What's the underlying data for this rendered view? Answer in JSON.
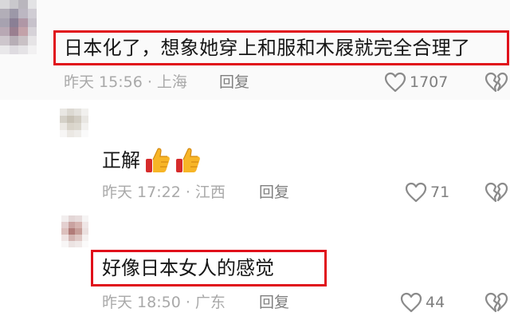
{
  "comments": [
    {
      "text": "日本化了，想象她穿上和服和木屐就完全合理了",
      "time": "昨天 15:56 · 上海",
      "reply_label": "回复",
      "like_count": "1707"
    },
    {
      "text": "正解",
      "emoji": [
        "thumbs-up-emoji",
        "thumbs-up-emoji"
      ],
      "time": "昨天 17:22 · 江西",
      "reply_label": "回复",
      "like_count": "71"
    },
    {
      "text": "好像日本女人的感觉",
      "time": "昨天 18:50 · 广东",
      "reply_label": "回复",
      "like_count": "44"
    }
  ],
  "icons": {
    "like": "heart-outline-icon",
    "dislike": "broken-heart-outline-icon"
  },
  "colors": {
    "highlight_border": "#e0101a",
    "meta_text": "#a9a9a9",
    "action_text": "#7f7f7f",
    "comment_text": "#161616",
    "first_row_bg": "#fafafa"
  }
}
